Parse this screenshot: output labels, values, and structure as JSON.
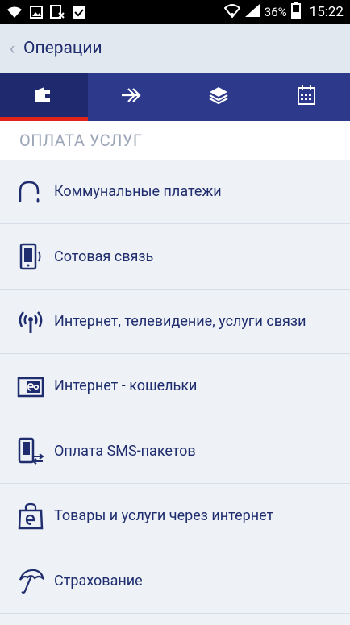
{
  "status_bar": {
    "battery": "36%",
    "time": "15:22"
  },
  "header": {
    "title": "Операции"
  },
  "tabs": [
    {
      "icon": "wallet-icon",
      "active": true
    },
    {
      "icon": "double-arrow-right-icon",
      "active": false
    },
    {
      "icon": "layers-icon",
      "active": false
    },
    {
      "icon": "calendar-icon",
      "active": false
    }
  ],
  "section": {
    "title": "ОПЛАТА УСЛУГ"
  },
  "items": [
    {
      "label": "Коммунальные платежи",
      "icon": "faucet-icon"
    },
    {
      "label": "Сотовая связь",
      "icon": "mobile-phone-icon"
    },
    {
      "label": "Интернет, телевидение, услуги связи",
      "icon": "broadcast-antenna-icon"
    },
    {
      "label": "Интернет - кошельки",
      "icon": "e-wallet-icon"
    },
    {
      "label": "Оплата SMS-пакетов",
      "icon": "phone-transfer-icon"
    },
    {
      "label": "Товары и услуги через интернет",
      "icon": "shopping-bag-icon"
    },
    {
      "label": "Страхование",
      "icon": "umbrella-icon"
    }
  ],
  "colors": {
    "primary": "#2d3a8c",
    "accent": "#e2231a",
    "text": "#1f2d6e"
  }
}
